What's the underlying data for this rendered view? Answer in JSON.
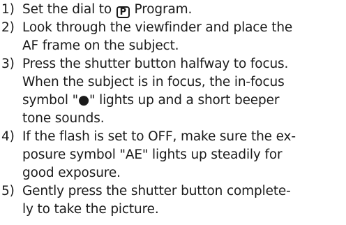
{
  "steps": [
    {
      "number": "1)",
      "before_icon": "Set the dial to ",
      "icon_label": "P",
      "icon_name": "program-mode-icon",
      "after_icon": " Program."
    },
    {
      "number": "2)",
      "text": "Look through the viewfinder and place the\nAF frame on the subject."
    },
    {
      "number": "3)",
      "text": "Press the shutter button halfway to focus.\nWhen the subject is in focus, the in-focus\nsymbol \"●\" lights up and a short beeper\ntone sounds."
    },
    {
      "number": "4)",
      "text": "If the flash is set to OFF, make sure the ex-\nposure symbol \"AE\" lights up steadily for\ngood exposure."
    },
    {
      "number": "5)",
      "text": "Gently press the shutter button complete-\nly to take the picture."
    }
  ]
}
